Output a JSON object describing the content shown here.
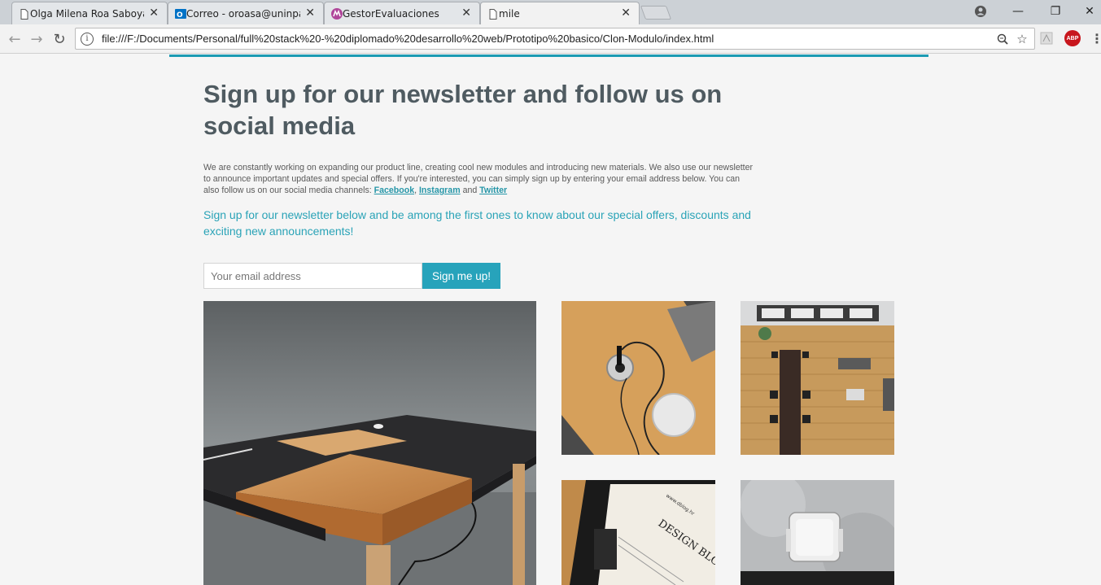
{
  "browser": {
    "tabs": [
      {
        "title": "Olga Milena Roa Saboya",
        "icon": "page-icon"
      },
      {
        "title": "Correo - oroasa@uninpa",
        "icon": "outlook-icon"
      },
      {
        "title": "GestorEvaluaciones",
        "icon": "app-icon"
      },
      {
        "title": "mile",
        "icon": "page-icon"
      }
    ],
    "url": "file:///F:/Documents/Personal/full%20stack%20-%20diplomado%20desarrollo%20web/Prototipo%20basico/Clon-Modulo/index.html"
  },
  "newsletter": {
    "heading": "Sign up for our newsletter and follow us on social media",
    "body": "We are constantly working on expanding our product line, creating cool new modules and introducing new materials. We also use our newsletter to announce important updates and special offers. If you're interested, you can simply sign up by entering your email address below. You can also follow us on our social media channels: ",
    "links": {
      "facebook": "Facebook",
      "instagram": "Instagram",
      "twitter": "Twitter"
    },
    "sep1": ", ",
    "sep2": " and ",
    "lead": "Sign up for our newsletter below and be among the first ones to know about our special offers, discounts and exciting new announcements!",
    "email_placeholder": "Your email address",
    "submit_label": "Sign me up!"
  },
  "gallery": {
    "blog_text": "DESIGN BLOG",
    "blog_url": "www.dblog.hr"
  },
  "colors": {
    "accent": "#27a3bb",
    "heading": "#4f5b61"
  }
}
